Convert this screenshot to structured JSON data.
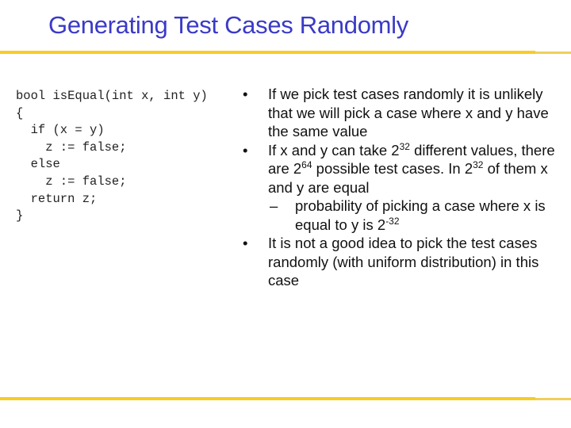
{
  "slide": {
    "title": "Generating Test Cases Randomly",
    "accent_color": "#f7cc25",
    "title_color": "#3a3ac8"
  },
  "code": {
    "lines": [
      "bool isEqual(int x, int y)",
      "{",
      "  if (x = y)",
      "    z := false;",
      "  else",
      "    z := false;",
      "  return z;",
      "}"
    ]
  },
  "bullets": [
    {
      "marker": "•",
      "text": "If we pick test cases randomly it is unlikely that we will pick a case where x and y have the same value"
    },
    {
      "marker": "•",
      "parts": {
        "a": "If x and y can take 2",
        "a_sup": "32",
        "b": " different values, there are 2",
        "b_sup": "64",
        "c": " possible test cases. In 2",
        "c_sup": "32",
        "d": " of them x and y are equal"
      },
      "sub": [
        {
          "marker": "–",
          "text": "probability of picking a case where x is equal to y is 2",
          "sup": "-32"
        }
      ]
    },
    {
      "marker": "•",
      "text": "It is not a good idea to pick the test cases randomly (with uniform distribution) in this case"
    }
  ]
}
